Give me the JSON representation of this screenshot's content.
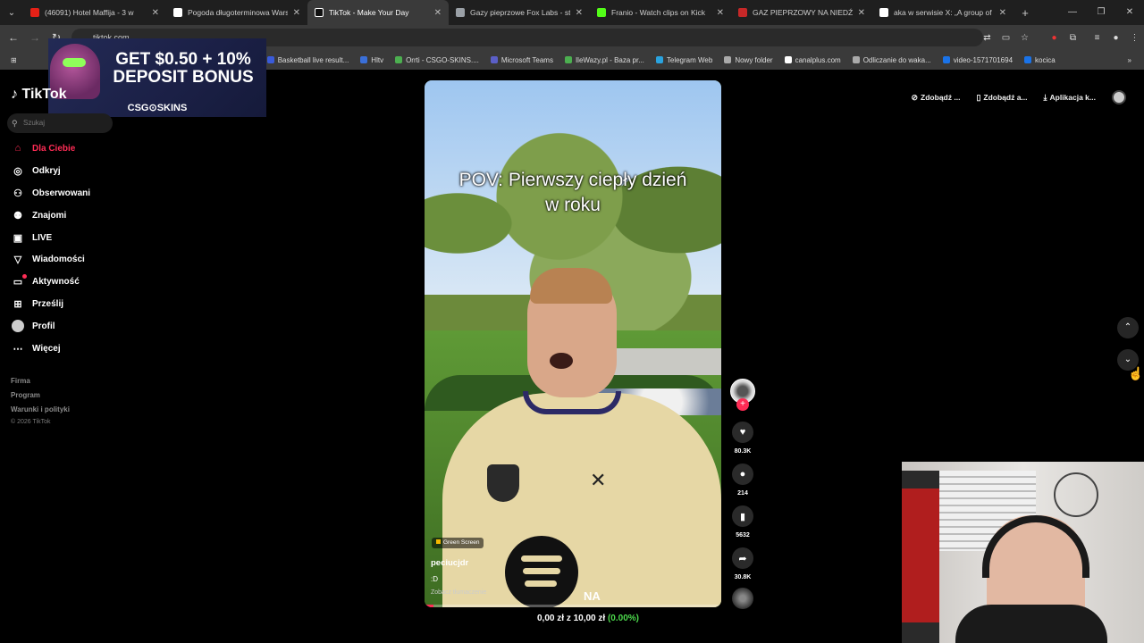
{
  "browser": {
    "tabs": [
      {
        "label": "(46091) Hotel Maffija - 3 w",
        "color": "#e62117"
      },
      {
        "label": "Pogoda długoterminowa Wars",
        "color": "#ffffff"
      },
      {
        "label": "TikTok - Make Your Day",
        "color": "#ffffff",
        "active": true
      },
      {
        "label": "Gazy pieprzowe Fox Labs - sto",
        "color": "#9aa0a6"
      },
      {
        "label": "Franio - Watch clips on Kick",
        "color": "#53fc18"
      },
      {
        "label": "GAZ PIEPRZOWY NA NIEDŹWI",
        "color": "#c62828"
      },
      {
        "label": "aka w serwisie X: „A group of s",
        "color": "#ffffff"
      }
    ],
    "address": "tiktok.com",
    "bookmarks": [
      {
        "label": "Basketball live result...",
        "color": "#3a5bd9"
      },
      {
        "label": "Hltv",
        "color": "#3a6fd8"
      },
      {
        "label": "Orrti - CSGO-SKINS....",
        "color": "#4caf50"
      },
      {
        "label": "Microsoft Teams",
        "color": "#5b5fc7"
      },
      {
        "label": "IleWazy.pl - Baza pr...",
        "color": "#4caf50"
      },
      {
        "label": "Telegram Web",
        "color": "#2aa3df"
      },
      {
        "label": "Nowy folder",
        "color": "#aaaaaa"
      },
      {
        "label": "canalplus.com",
        "color": "#ffffff"
      },
      {
        "label": "Odliczanie do waka...",
        "color": "#aaaaaa"
      },
      {
        "label": "video-1571701694",
        "color": "#1a73e8"
      },
      {
        "label": "kocica",
        "color": "#1a73e8"
      }
    ]
  },
  "ad": {
    "headline": "GET $0.50 + 10% DEPOSIT BONUS",
    "brand": "CSG⊙SKINS"
  },
  "tiktok": {
    "logo": "TikTok",
    "search_placeholder": "Szukaj",
    "nav": [
      {
        "label": "Dla Ciebie",
        "icon": "home-icon",
        "active": true
      },
      {
        "label": "Odkryj",
        "icon": "compass-icon"
      },
      {
        "label": "Obserwowani",
        "icon": "following-icon"
      },
      {
        "label": "Znajomi",
        "icon": "friends-icon"
      },
      {
        "label": "LIVE",
        "icon": "live-icon"
      },
      {
        "label": "Wiadomości",
        "icon": "messages-icon"
      },
      {
        "label": "Aktywność",
        "icon": "activity-icon"
      },
      {
        "label": "Prześlij",
        "icon": "upload-icon"
      },
      {
        "label": "Profil",
        "icon": "profile-icon"
      },
      {
        "label": "Więcej",
        "icon": "more-icon"
      }
    ],
    "footer_links": [
      "Firma",
      "Program",
      "Warunki i polityki"
    ],
    "copyright": "© 2026 TikTok",
    "top_actions": [
      "Zdobądź ...",
      "Zdobądź a...",
      "Aplikacja k..."
    ]
  },
  "video": {
    "caption": "POV: Pierwszy ciepły dzień w roku",
    "effect_badge": "Green Screen",
    "author": "peciucjdr",
    "description": ":D",
    "translate": "Zobacz tłumaczenie",
    "overlay_text": "NA",
    "progress": 0.03,
    "likes": "80.3K",
    "comments": "214",
    "saves": "5632",
    "shares": "30.8K"
  },
  "donation": {
    "current": "0,00 zł",
    "separator": "z",
    "goal": "10,00 zł",
    "percent": "(0.00%)"
  }
}
